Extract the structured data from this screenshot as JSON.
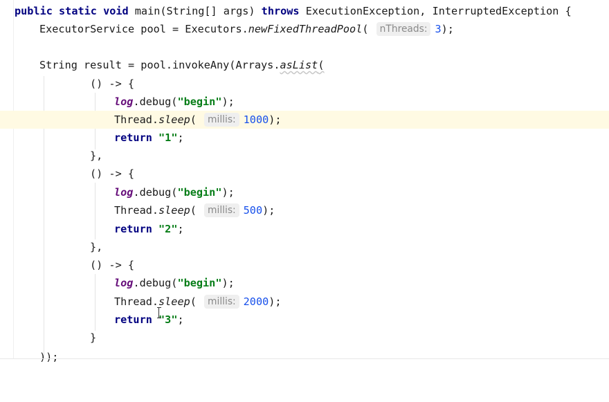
{
  "editor": {
    "method_signature": {
      "kw_public": "public",
      "kw_static": "static",
      "kw_void": "void",
      "name_and_params": " main(String[] args) ",
      "kw_throws": "throws",
      "exceptions": " ExecutionException, InterruptedException {"
    },
    "pool_line": {
      "prefix": "ExecutorService pool = Executors.",
      "method": "newFixedThreadPool",
      "open": "(",
      "hint": "nThreads:",
      "arg": "3",
      "close": ");"
    },
    "result_line": {
      "prefix": "String result = pool.invokeAny(Arrays.",
      "method": "asList",
      "open": "("
    },
    "lambda_open": "() -> {",
    "log_field": "log",
    "debug_call": ".debug(",
    "begin_literal": "\"begin\"",
    "debug_close": ");",
    "thread_prefix": "Thread.",
    "sleep_method": "sleep",
    "sleep_open": "(",
    "millis_hint": "millis:",
    "sleep_close": ");",
    "kw_return": "return",
    "semicolon": ";",
    "lambda_close_comma": "},",
    "lambda_close": "}",
    "list_close": "));",
    "tasks": [
      {
        "millis": "1000",
        "result": "\"1\""
      },
      {
        "millis": "500",
        "result": "\"2\""
      },
      {
        "millis": "2000",
        "result": "\"3\""
      }
    ]
  }
}
